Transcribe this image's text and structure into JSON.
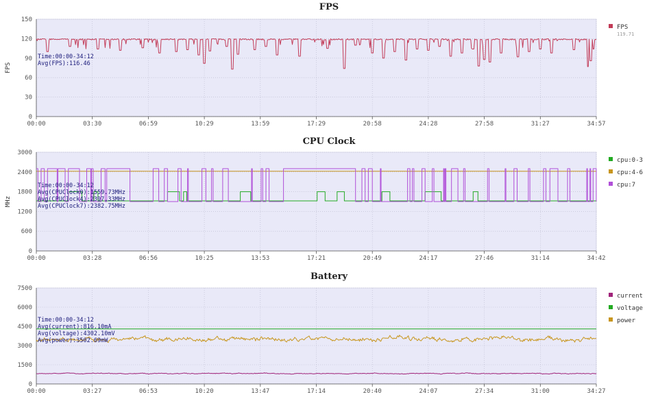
{
  "chart_data": [
    {
      "type": "line",
      "title": "FPS",
      "ylabel": "FPS",
      "ylim": [
        0,
        150
      ],
      "yticks": [
        "0",
        "30",
        "60",
        "90",
        "120",
        "150"
      ],
      "xticks": [
        "00:00",
        "03:30",
        "06:59",
        "10:29",
        "13:59",
        "17:29",
        "20:58",
        "24:28",
        "27:58",
        "31:27",
        "34:57"
      ],
      "annotations": [
        "Time:00:00-34:12",
        "Avg(FPS):116.46"
      ],
      "legend": [
        {
          "name": "FPS",
          "sub": "119.71",
          "color": "#c23b57"
        }
      ],
      "series": [
        {
          "name": "FPS",
          "color": "#c23b57",
          "baseline": 120,
          "noise": 2,
          "dips": [
            [
              0.02,
              100
            ],
            [
              0.06,
              108
            ],
            [
              0.11,
              104
            ],
            [
              0.15,
              102
            ],
            [
              0.19,
              106
            ],
            [
              0.22,
              98
            ],
            [
              0.25,
              100
            ],
            [
              0.27,
              103
            ],
            [
              0.29,
              95
            ],
            [
              0.3,
              82
            ],
            [
              0.31,
              101
            ],
            [
              0.34,
              108
            ],
            [
              0.35,
              73
            ],
            [
              0.36,
              96
            ],
            [
              0.39,
              103
            ],
            [
              0.41,
              108
            ],
            [
              0.43,
              95
            ],
            [
              0.47,
              93
            ],
            [
              0.52,
              105
            ],
            [
              0.55,
              74
            ],
            [
              0.57,
              110
            ],
            [
              0.6,
              98
            ],
            [
              0.62,
              90
            ],
            [
              0.64,
              100
            ],
            [
              0.66,
              87
            ],
            [
              0.68,
              104
            ],
            [
              0.7,
              102
            ],
            [
              0.72,
              108
            ],
            [
              0.74,
              93
            ],
            [
              0.76,
              98
            ],
            [
              0.78,
              104
            ],
            [
              0.79,
              78
            ],
            [
              0.8,
              88
            ],
            [
              0.81,
              84
            ],
            [
              0.83,
              98
            ],
            [
              0.86,
              92
            ],
            [
              0.88,
              100
            ],
            [
              0.9,
              104
            ],
            [
              0.92,
              98
            ],
            [
              0.96,
              103
            ],
            [
              0.985,
              77
            ],
            [
              0.99,
              86
            ],
            [
              0.995,
              104
            ]
          ]
        }
      ]
    },
    {
      "type": "line",
      "title": "CPU Clock",
      "ylabel": "MHz",
      "ylim": [
        0,
        3000
      ],
      "yticks": [
        "0",
        "600",
        "1200",
        "1800",
        "2400",
        "3000"
      ],
      "xticks": [
        "00:00",
        "03:28",
        "06:56",
        "10:25",
        "13:53",
        "17:21",
        "20:49",
        "24:17",
        "27:46",
        "31:14",
        "34:42"
      ],
      "annotations": [
        "Time:00:00-34:12",
        "Avg(CPUClock0):1559.73MHz",
        "Avg(CPUClock4):2397.33MHz",
        "Avg(CPUClock7):2382.75MHz"
      ],
      "legend": [
        {
          "name": "cpu:0-3",
          "color": "#22aa22"
        },
        {
          "name": "cpu:4-6",
          "color": "#c8961e"
        },
        {
          "name": "cpu:7",
          "color": "#b04fd8"
        }
      ],
      "series": [
        {
          "name": "cpu:0-3",
          "color": "#22aa22",
          "low": 1520,
          "high": 1800
        },
        {
          "name": "cpu:4-6",
          "color": "#c8961e",
          "value": 2420
        },
        {
          "name": "cpu:7",
          "color": "#b04fd8",
          "low": 1500,
          "high": 2500
        }
      ]
    },
    {
      "type": "line",
      "title": "Battery",
      "ylabel": "",
      "ylim": [
        0,
        7500
      ],
      "yticks": [
        "0",
        "1500",
        "3000",
        "4500",
        "6000",
        "7500"
      ],
      "xticks": [
        "00:00",
        "03:27",
        "06:53",
        "10:20",
        "13:47",
        "17:14",
        "20:40",
        "24:07",
        "27:34",
        "31:00",
        "34:27"
      ],
      "annotations": [
        "Time:00:00-34:12",
        "Avg(current):816.10mA",
        "Avg(voltage):4302.10mV",
        "Avg(power):3502.69mW"
      ],
      "legend": [
        {
          "name": "current",
          "color": "#a0237a"
        },
        {
          "name": "voltage",
          "color": "#22aa22"
        },
        {
          "name": "power",
          "color": "#c8961e"
        }
      ],
      "series": [
        {
          "name": "current",
          "color": "#a0237a",
          "mean": 816,
          "noise": 60
        },
        {
          "name": "voltage",
          "color": "#22aa22",
          "mean": 4302,
          "noise": 0
        },
        {
          "name": "power",
          "color": "#c8961e",
          "mean": 3502,
          "noise": 300
        }
      ]
    }
  ]
}
